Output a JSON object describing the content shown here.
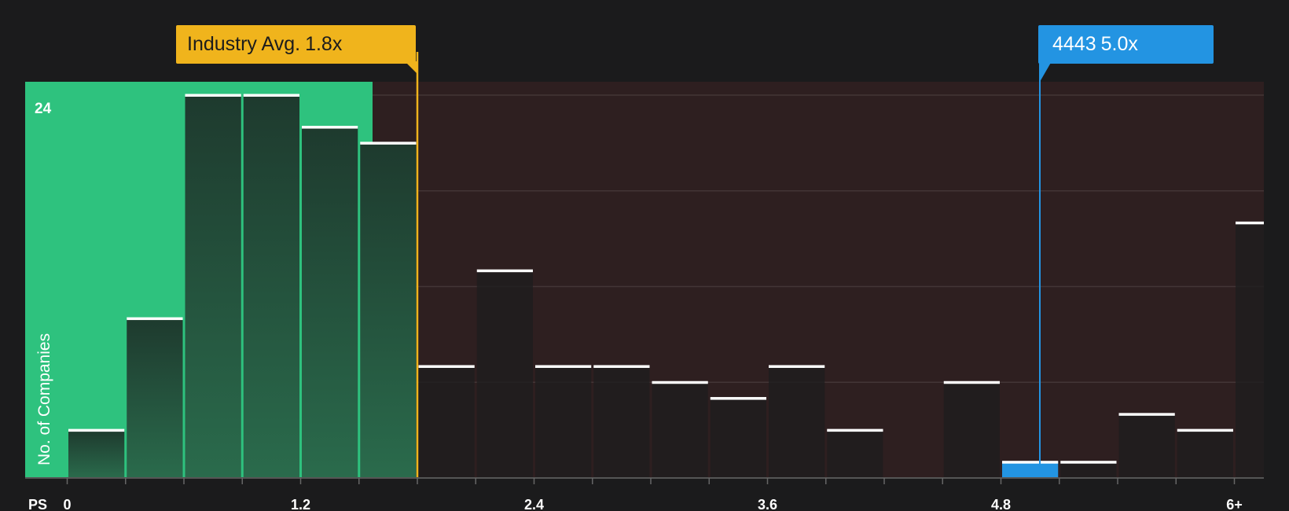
{
  "chart_data": {
    "type": "bar",
    "metric_label": "PS",
    "ylabel": "No. of Companies",
    "y_top_label": "24",
    "ylim": [
      0,
      25
    ],
    "x_ticks": [
      "0",
      "1.2",
      "2.4",
      "3.6",
      "4.8",
      "6+"
    ],
    "bins": [
      {
        "x0": 0.0,
        "x1": 0.3,
        "count": 3
      },
      {
        "x0": 0.3,
        "x1": 0.6,
        "count": 10
      },
      {
        "x0": 0.6,
        "x1": 0.9,
        "count": 24
      },
      {
        "x0": 0.9,
        "x1": 1.2,
        "count": 24
      },
      {
        "x0": 1.2,
        "x1": 1.5,
        "count": 22
      },
      {
        "x0": 1.5,
        "x1": 1.8,
        "count": 21
      },
      {
        "x0": 1.8,
        "x1": 2.1,
        "count": 7
      },
      {
        "x0": 2.1,
        "x1": 2.4,
        "count": 13
      },
      {
        "x0": 2.4,
        "x1": 2.7,
        "count": 7
      },
      {
        "x0": 2.7,
        "x1": 3.0,
        "count": 7
      },
      {
        "x0": 3.0,
        "x1": 3.3,
        "count": 6
      },
      {
        "x0": 3.3,
        "x1": 3.6,
        "count": 5
      },
      {
        "x0": 3.6,
        "x1": 3.9,
        "count": 7
      },
      {
        "x0": 3.9,
        "x1": 4.2,
        "count": 3
      },
      {
        "x0": 4.2,
        "x1": 4.5,
        "count": 0
      },
      {
        "x0": 4.5,
        "x1": 4.8,
        "count": 6
      },
      {
        "x0": 4.8,
        "x1": 5.1,
        "count": 1,
        "highlight": true
      },
      {
        "x0": 5.1,
        "x1": 5.4,
        "count": 1
      },
      {
        "x0": 5.4,
        "x1": 5.7,
        "count": 4
      },
      {
        "x0": 5.7,
        "x1": 6.0,
        "count": 3
      },
      {
        "x0": 6.0,
        "x1": 6.3,
        "count": 16
      }
    ],
    "industry_avg": {
      "label": "Industry Avg.",
      "value_label": "1.8x",
      "value": 1.8
    },
    "company": {
      "ticker": "4443",
      "value_label": "5.0x",
      "value": 5.0
    },
    "colors": {
      "background": "#1b1b1c",
      "undervalued_region": "#2ec27e",
      "overvalued_region": "#2e1f20",
      "industry_avg": "#f0b41c",
      "company": "#2394e2",
      "bar_cap": "#ffffff"
    },
    "grid": true
  }
}
